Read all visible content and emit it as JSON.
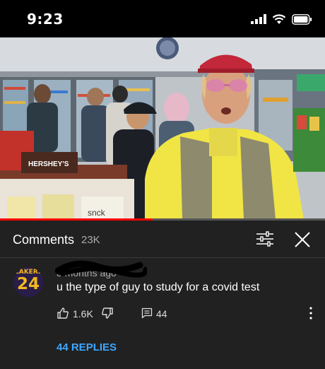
{
  "status_bar": {
    "time": "9:23",
    "icons": [
      "cellular-signal-icon",
      "wifi-icon",
      "battery-icon"
    ]
  },
  "video": {
    "description_visible_text": [
      "HERSHEY'S",
      "snck"
    ],
    "progress_fraction": 0.47,
    "progress_color": "#ff0000"
  },
  "comments_panel": {
    "title": "Comments",
    "count": "23K",
    "sort_icon": "sliders-icon",
    "close_icon": "close-icon"
  },
  "comment": {
    "avatar_team": "LAKERS",
    "avatar_number": "24",
    "meta_visible": "3 months ago",
    "text": "u the type of guy to study for a covid test",
    "likes": "1.6K",
    "replies": "44",
    "view_replies_label": "44 REPLIES"
  },
  "colors": {
    "background": "#212121",
    "accent_link": "#3ea6ff",
    "avatar_gold": "#f2b71c",
    "avatar_purple": "#2a1d4a"
  }
}
